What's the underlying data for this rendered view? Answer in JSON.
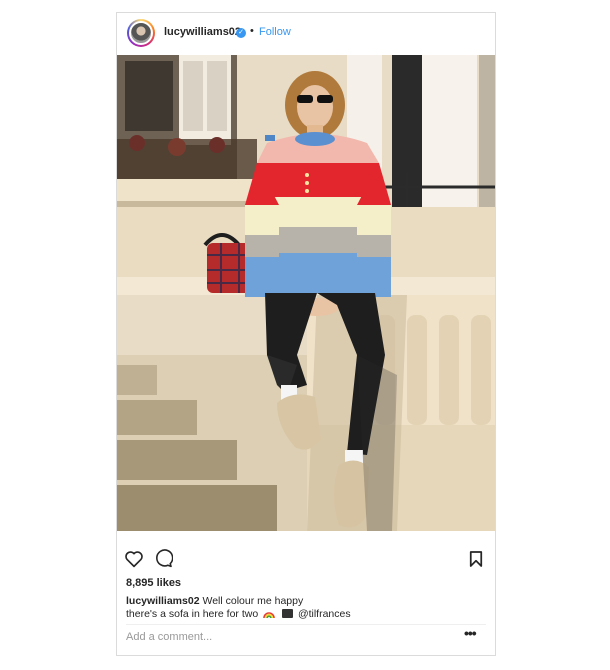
{
  "post": {
    "username": "lucywilliams02",
    "verified_icon": "verified-badge-icon",
    "separator": "•",
    "follow_label": "Follow",
    "likes": "8,895 likes",
    "caption_user": "lucywilliams02",
    "caption_line1": "Well colour me happy",
    "caption_line2": "there's a sofa in here for two",
    "caption_mention": "@tilfrances",
    "comment_placeholder": "Add a comment...",
    "more_label": "•••"
  },
  "colors": {
    "link_blue": "#3897f0",
    "text": "#262626",
    "border": "#dbdbdb",
    "placeholder": "#999999"
  },
  "icons": {
    "like": "heart-icon",
    "comment": "comment-bubble-icon",
    "save": "bookmark-icon"
  }
}
